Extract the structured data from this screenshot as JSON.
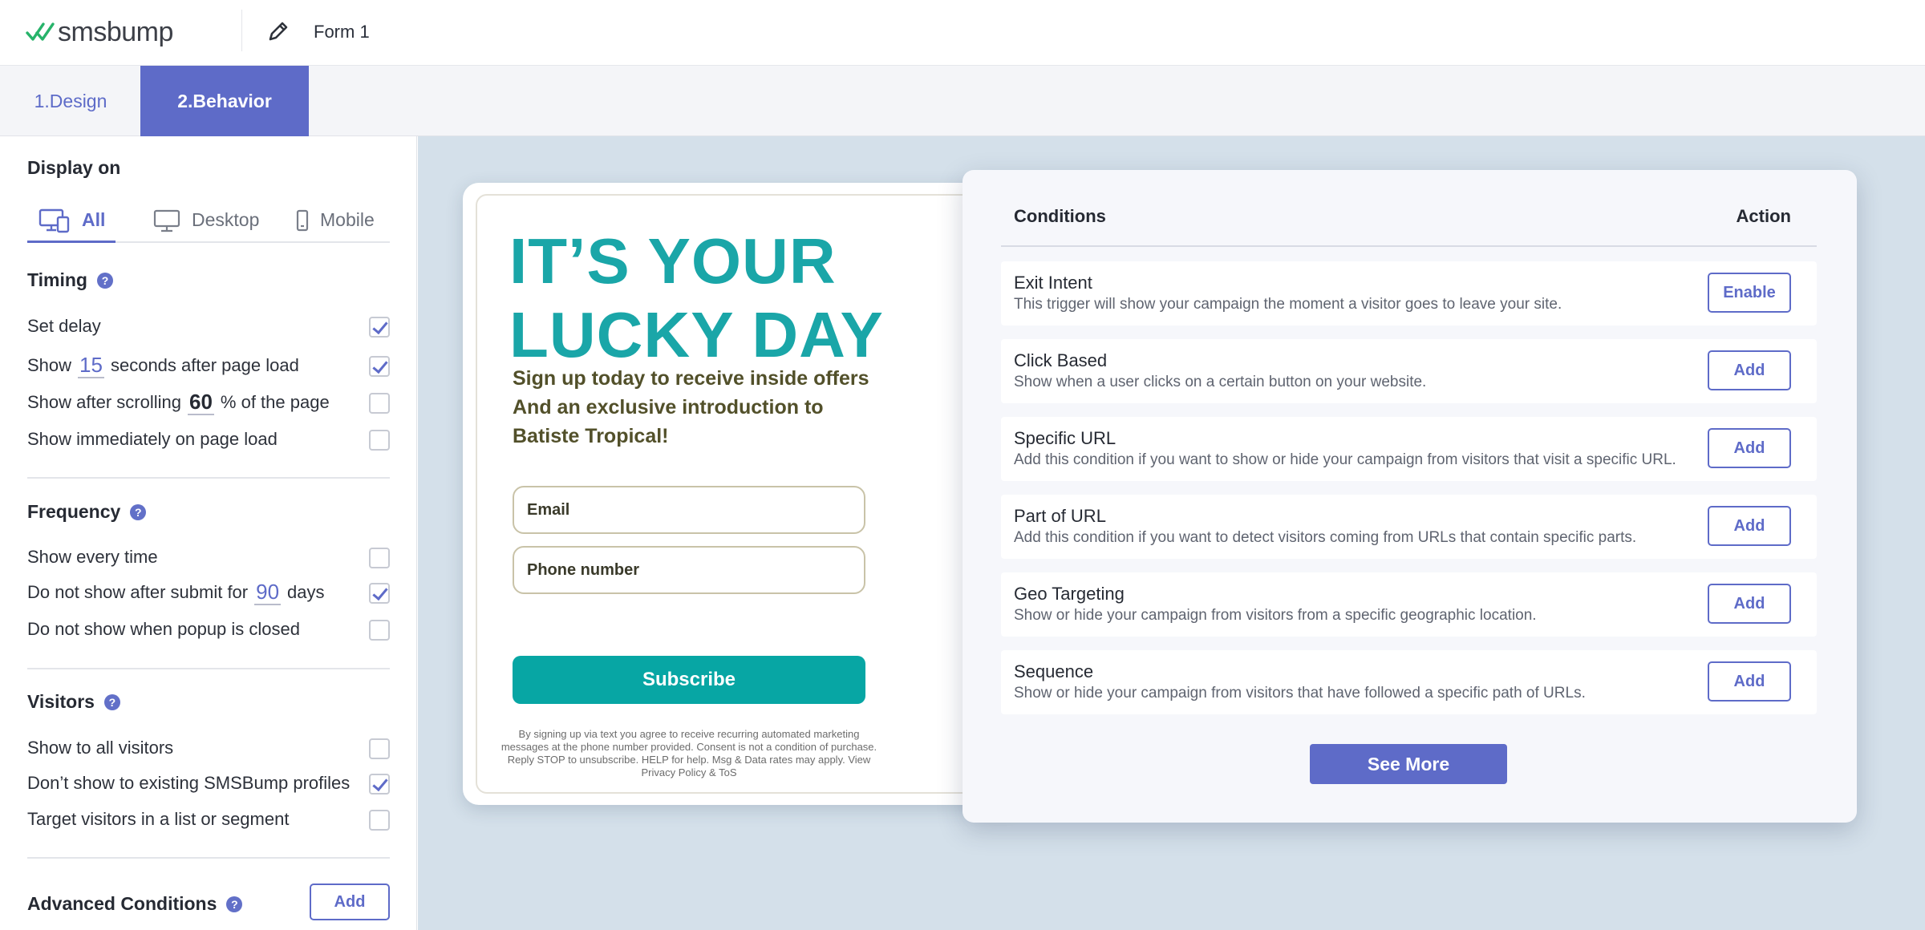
{
  "header": {
    "logo_text": "smsbump",
    "form_name": "Form 1"
  },
  "tabs": [
    {
      "label": "1.Design",
      "active": false
    },
    {
      "label": "2.Behavior",
      "active": true
    }
  ],
  "sidebar": {
    "display_on": {
      "title": "Display on",
      "options": [
        {
          "label": "All",
          "icon": "all-devices-icon",
          "active": true
        },
        {
          "label": "Desktop",
          "icon": "desktop-icon",
          "active": false
        },
        {
          "label": "Mobile",
          "icon": "mobile-icon",
          "active": false
        }
      ]
    },
    "timing": {
      "title": "Timing",
      "set_delay": {
        "label": "Set delay",
        "checked": true
      },
      "show_after_load": {
        "before": "Show",
        "value": "15",
        "after": "seconds after page load",
        "checked": true
      },
      "show_after_scroll": {
        "before": "Show after scrolling",
        "value": "60",
        "after": "% of the page",
        "checked": false
      },
      "show_immediately": {
        "label": "Show immediately on page load",
        "checked": false
      }
    },
    "frequency": {
      "title": "Frequency",
      "show_every_time": {
        "label": "Show every time",
        "checked": false
      },
      "after_submit": {
        "before": "Do not show after submit for",
        "value": "90",
        "after": "days",
        "checked": true
      },
      "when_closed": {
        "label": "Do not show when popup is closed",
        "checked": false
      }
    },
    "visitors": {
      "title": "Visitors",
      "all_visitors": {
        "label": "Show to all visitors",
        "checked": false
      },
      "existing_profiles": {
        "label": "Don’t show to existing SMSBump profiles",
        "checked": true
      },
      "list_segment": {
        "label": "Target visitors in a list or segment",
        "checked": false
      }
    },
    "advanced": {
      "title": "Advanced Conditions",
      "add_label": "Add"
    }
  },
  "popup": {
    "headline_line1": "IT’S YOUR",
    "headline_line2": "LUCKY DAY",
    "subheading_line1": "Sign up today to receive inside offers",
    "subheading_line2": "And an exclusive introduction to",
    "subheading_line3": "Batiste Tropical!",
    "email_placeholder": "Email",
    "phone_placeholder": "Phone number",
    "subscribe_label": "Subscribe",
    "fineprint_line1": "By signing up via text you agree to receive recurring automated marketing",
    "fineprint_line2": "messages at the phone number provided. Consent is not a condition of purchase.",
    "fineprint_line3": "Reply STOP to unsubscribe. HELP for help. Msg & Data rates may apply. View",
    "fineprint_line4": "Privacy Policy & ToS"
  },
  "conditions": {
    "col_conditions": "Conditions",
    "col_action": "Action",
    "items": [
      {
        "title": "Exit Intent",
        "desc": "This trigger will show your campaign the moment a visitor goes to leave your site.",
        "action": "Enable"
      },
      {
        "title": "Click Based",
        "desc": "Show when a user clicks on a certain button on your website.",
        "action": "Add"
      },
      {
        "title": "Specific URL",
        "desc": "Add this condition if you want to show or hide your campaign from visitors that visit a specific URL.",
        "action": "Add"
      },
      {
        "title": "Part of URL",
        "desc": "Add this condition if you want to detect visitors coming from URLs that contain specific parts.",
        "action": "Add"
      },
      {
        "title": "Geo Targeting",
        "desc": "Show or hide your campaign from visitors from a specific geographic location.",
        "action": "Add"
      },
      {
        "title": "Sequence",
        "desc": "Show or hide your campaign from visitors that have followed a specific path of URLs.",
        "action": "Add"
      }
    ],
    "see_more_label": "See More"
  },
  "colors": {
    "accent": "#5e6bc8",
    "teal": "#1aa6a8",
    "canvas_bg": "#d4e0ea"
  }
}
